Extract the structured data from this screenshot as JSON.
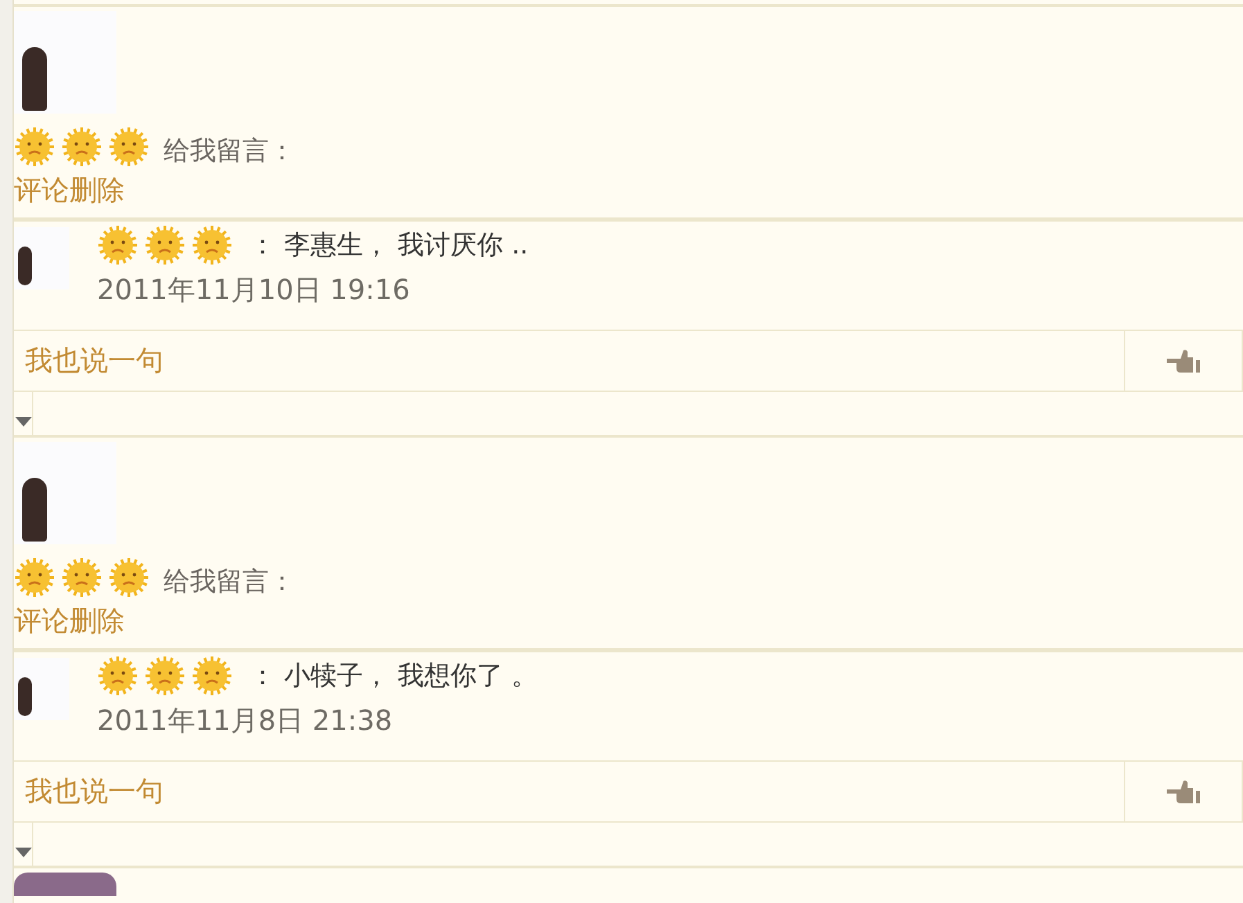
{
  "posts": [
    {
      "message_label": "给我留言：",
      "delete_link": "评论删除",
      "reply": {
        "text": "： 李惠生， 我讨厌你 ..",
        "date": "2011年11月10日 19:16"
      },
      "comment_prompt": "我也说一句"
    },
    {
      "message_label": "给我留言：",
      "delete_link": "评论删除",
      "reply": {
        "text": "： 小犊子， 我想你了 。",
        "date": "2011年11月8日 21:38"
      },
      "comment_prompt": "我也说一句"
    }
  ]
}
